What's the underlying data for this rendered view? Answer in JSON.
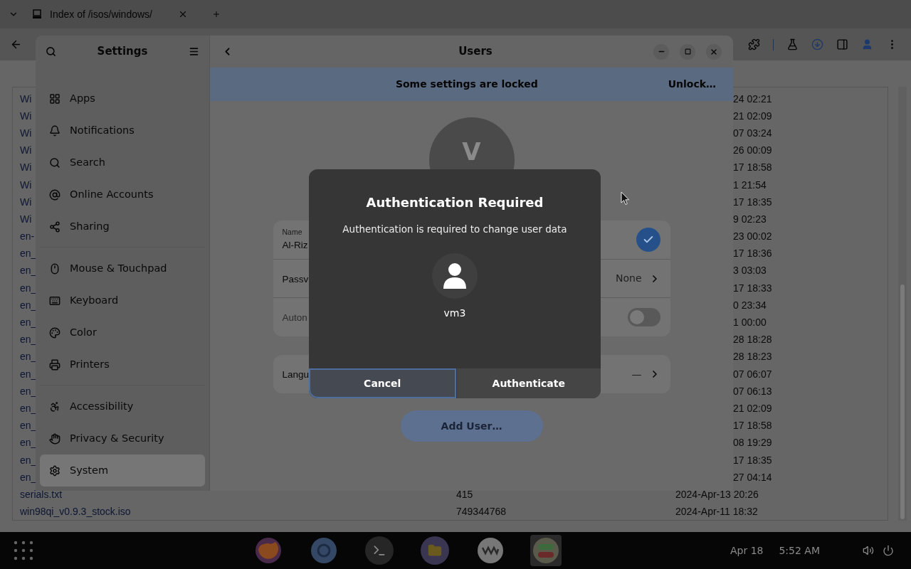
{
  "browser": {
    "tab": {
      "title": "Index of /isos/windows/"
    },
    "listing": {
      "rows": [
        {
          "name": "Wi",
          "date": "24 02:21"
        },
        {
          "name": "Wi",
          "date": "21 02:09"
        },
        {
          "name": "Wi",
          "date": "07 03:24"
        },
        {
          "name": "Wi",
          "date": "26 00:09"
        },
        {
          "name": "Wi",
          "date": "17 18:58"
        },
        {
          "name": "Wi",
          "date": "1 21:54"
        },
        {
          "name": "Wi",
          "date": "17 18:35"
        },
        {
          "name": "Wi",
          "date": "9 02:23"
        },
        {
          "name": "en-",
          "date": "23 00:02"
        },
        {
          "name": "en_",
          "date": "17 18:36"
        },
        {
          "name": "en_",
          "date": "3 03:03"
        },
        {
          "name": "en_",
          "date": "17 18:33"
        },
        {
          "name": "en_",
          "date": "0 23:34"
        },
        {
          "name": "en_",
          "date": "1 00:00"
        },
        {
          "name": "en_",
          "date": "28 18:28"
        },
        {
          "name": "en_",
          "date": "28 18:23"
        },
        {
          "name": "en_",
          "date": "07 06:07"
        },
        {
          "name": "en_",
          "date": "07 06:13"
        },
        {
          "name": "en_",
          "date": "21 02:09"
        },
        {
          "name": "en_",
          "date": "17 18:58"
        },
        {
          "name": "en_",
          "date": "08 19:29"
        },
        {
          "name": "en_",
          "date": "17 18:35"
        },
        {
          "name": "en_",
          "date": "27 04:14"
        },
        {
          "name": "serials.txt",
          "size": "415",
          "date": "2024-Apr-13 20:26"
        },
        {
          "name": "win98qi_v0.9.3_stock.iso",
          "size": "749344768",
          "date": "2024-Apr-11 18:32"
        }
      ]
    }
  },
  "settings": {
    "title": "Settings",
    "sidebar": {
      "groups": [
        [
          {
            "label": "Apps",
            "selected": false
          },
          {
            "label": "Notifications",
            "selected": false
          },
          {
            "label": "Search",
            "selected": false
          },
          {
            "label": "Online Accounts",
            "selected": false
          },
          {
            "label": "Sharing",
            "selected": false
          }
        ],
        [
          {
            "label": "Mouse & Touchpad",
            "selected": false
          },
          {
            "label": "Keyboard",
            "selected": false
          },
          {
            "label": "Color",
            "selected": false
          },
          {
            "label": "Printers",
            "selected": false
          }
        ],
        [
          {
            "label": "Accessibility",
            "selected": false
          },
          {
            "label": "Privacy & Security",
            "selected": false
          },
          {
            "label": "System",
            "selected": true
          }
        ]
      ]
    }
  },
  "users": {
    "title": "Users",
    "banner": {
      "text": "Some settings are locked",
      "button": "Unlock…"
    },
    "avatar_letter": "V",
    "cards": [
      [
        {
          "kind": "name",
          "label": "Name",
          "value": "Al-Riz"
        },
        {
          "kind": "link",
          "label": "Passv",
          "value": "None"
        },
        {
          "kind": "switch",
          "label": "Auton",
          "on": false,
          "disabled": true
        }
      ],
      [
        {
          "kind": "link",
          "label": "Langu",
          "value": "—"
        }
      ]
    ],
    "add_user": {
      "label": "Add User…",
      "disabled": true
    }
  },
  "dialog": {
    "title": "Authentication Required",
    "message": "Authentication is required to change user data",
    "user": "vm3",
    "buttons": [
      {
        "label": "Cancel",
        "selected": true
      },
      {
        "label": "Authenticate",
        "selected": false
      }
    ]
  },
  "taskbar": {
    "apps": [
      {
        "active": false
      },
      {
        "active": false
      },
      {
        "active": false
      },
      {
        "active": false
      },
      {
        "active": false
      },
      {
        "active": true
      }
    ],
    "date": "Apr 18",
    "time": "5:52 AM"
  }
}
